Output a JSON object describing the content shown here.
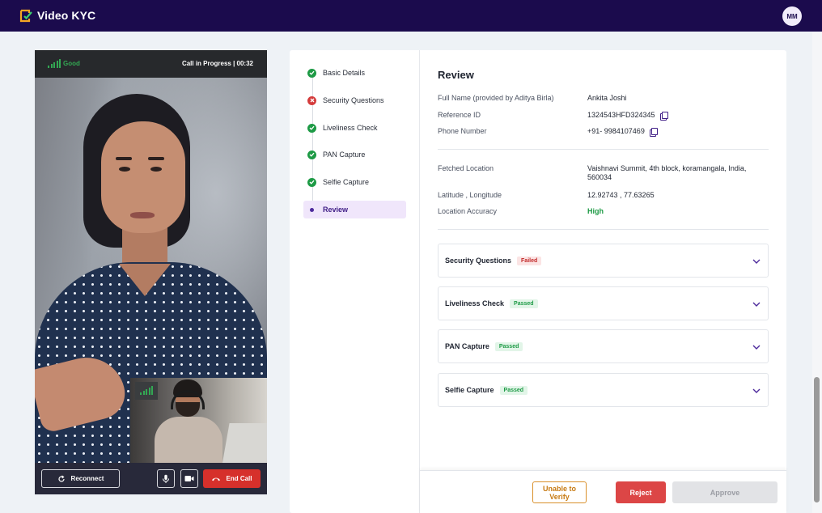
{
  "app": {
    "title": "Video KYC",
    "user_initials": "MM",
    "brand_color": "#1b0b4d",
    "logo_icon": "video-kyc-logo-icon"
  },
  "call": {
    "signal_label": "Good",
    "status": "Call in Progress | 00:32",
    "signal_color": "#33a853",
    "controls": {
      "reconnect_label": "Reconnect",
      "mic_icon": "microphone-icon",
      "camera_icon": "video-camera-icon",
      "end_label": "End Call"
    }
  },
  "steps": [
    {
      "label": "Basic Details",
      "status": "done"
    },
    {
      "label": "Security Questions",
      "status": "failed"
    },
    {
      "label": "Liveliness Check",
      "status": "done"
    },
    {
      "label": "PAN Capture",
      "status": "done"
    },
    {
      "label": "Selfie Capture",
      "status": "done"
    },
    {
      "label": "Review",
      "status": "active"
    }
  ],
  "review": {
    "title": "Review",
    "details": {
      "full_name_label": "Full Name (provided by Aditya Birla)",
      "full_name": "Ankita Joshi",
      "reference_label": "Reference ID",
      "reference": "1324543HFD324345",
      "phone_label": "Phone Number",
      "phone": "+91- 9984107469"
    },
    "location": {
      "fetched_label": "Fetched Location",
      "fetched": "Vaishnavi Summit, 4th block, koramangala, India, 560034",
      "latlong_label": "Latitude , Longitude",
      "latlong": "12.92743 , 77.63265",
      "accuracy_label": "Location Accuracy",
      "accuracy": "High"
    },
    "checks": [
      {
        "title": "Security Questions",
        "badge": "Failed",
        "status": "failed"
      },
      {
        "title": "Liveliness Check",
        "badge": "Passed",
        "status": "passed"
      },
      {
        "title": "PAN Capture",
        "badge": "Passed",
        "status": "passed"
      },
      {
        "title": "Selfie Capture",
        "badge": "Passed",
        "status": "passed"
      }
    ]
  },
  "actions": {
    "unable_label": "Unable to Verify",
    "reject_label": "Reject",
    "approve_label": "Approve"
  }
}
